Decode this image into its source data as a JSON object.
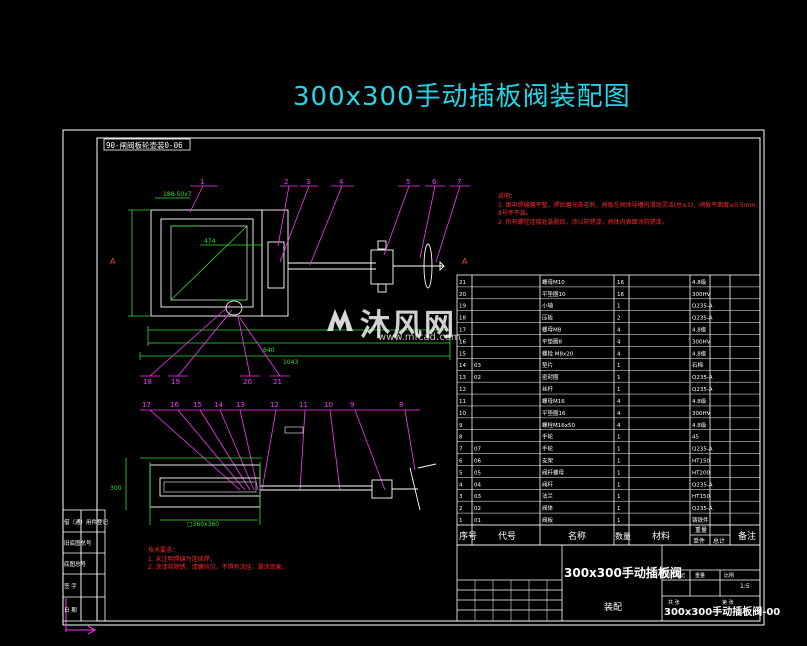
{
  "title": "300x300手动插板阀装配图",
  "view_label": "90-闸阀板轮壶装0-06",
  "balloons_top": [
    "1",
    "2",
    "3",
    "4",
    "5",
    "6",
    "7"
  ],
  "balloons_lower": [
    "18",
    "19",
    "20",
    "21"
  ],
  "balloons_side": [
    "17",
    "16",
    "15",
    "14",
    "13",
    "12",
    "11",
    "10",
    "9",
    "8"
  ],
  "dims": {
    "d1": "188-50x7",
    "d2": "474",
    "d3": "640",
    "d4": "1043",
    "d5": "300",
    "d6": "□360x360"
  },
  "tech_notes_top": {
    "heading": "说明：",
    "lines": [
      "1. 图中焊缝磨平整，焊后磨光去毛刺，阀板在阀体导槽内滑动灵活(总≤1)，阀板平面度≤0.5mm。",
      "   8号件不装。",
      "2. 所有螺栓连接处装配后，涂以防锈漆，阀体内表面涂防锈漆。"
    ]
  },
  "tech_notes_bottom": {
    "heading": "技术要求：",
    "lines": [
      "1. 未注明焊缝为连续焊。",
      "2. 涂漆前除锈，漆膜均匀，不得有流挂、漏涂现象。"
    ]
  },
  "bom": {
    "headers": [
      "序号",
      "代号",
      "名称",
      "数量",
      "材料",
      "单件",
      "总计",
      "备注"
    ],
    "weight_header": "重量",
    "rows": [
      [
        "21",
        "",
        "螺母M10",
        "16",
        "",
        "4.8级"
      ],
      [
        "20",
        "",
        "平垫圈10",
        "16",
        "",
        "300HV"
      ],
      [
        "19",
        "",
        "小轴",
        "1",
        "",
        "Q235-A"
      ],
      [
        "18",
        "",
        "压板",
        "2",
        "",
        "Q235-A"
      ],
      [
        "17",
        "",
        "螺母M8",
        "4",
        "",
        "4.8级"
      ],
      [
        "16",
        "",
        "平垫圈8",
        "4",
        "",
        "300HV"
      ],
      [
        "15",
        "",
        "螺栓 M8x20",
        "4",
        "",
        "4.8级"
      ],
      [
        "14",
        "03",
        "垫片",
        "1",
        "",
        "石棉"
      ],
      [
        "13",
        "02",
        "密封圈",
        "1",
        "",
        "Q235-A"
      ],
      [
        "12",
        "",
        "丝杆",
        "1",
        "",
        "Q235-A"
      ],
      [
        "11",
        "",
        "螺母M16",
        "4",
        "",
        "4.8级"
      ],
      [
        "10",
        "",
        "平垫圈16",
        "4",
        "",
        "300HV"
      ],
      [
        "9",
        "",
        "螺栓M16x50",
        "4",
        "",
        "4.8级"
      ],
      [
        "8",
        "",
        "手轮",
        "1",
        "",
        "45"
      ],
      [
        "7",
        "07",
        "手轮",
        "1",
        "",
        "Q235-A"
      ],
      [
        "6",
        "06",
        "支架",
        "1",
        "",
        "HT150"
      ],
      [
        "5",
        "05",
        "阀杆螺母",
        "1",
        "",
        "HT200"
      ],
      [
        "4",
        "04",
        "阀杆",
        "1",
        "",
        "Q235-A"
      ],
      [
        "3",
        "03",
        "法兰",
        "1",
        "",
        "HT150"
      ],
      [
        "2",
        "02",
        "阀体",
        "1",
        "",
        "Q235-A"
      ],
      [
        "1",
        "01",
        "阀板",
        "1",
        "",
        "铸铁件"
      ]
    ]
  },
  "title_block": {
    "part_name": "300x300手动插板阀",
    "drawing_no": "300x300手动插板阀-00",
    "assembly": "装配",
    "scale": "1:5",
    "labels": [
      "图样标记",
      "重量",
      "比例",
      "共 张",
      "第 张"
    ]
  },
  "left_strip": [
    "借（通）用件登记",
    "旧底图总号",
    "底图总号",
    "签 字",
    "日 期"
  ],
  "watermark": {
    "text": "沐风网",
    "sub": "www.mfcad.com"
  }
}
